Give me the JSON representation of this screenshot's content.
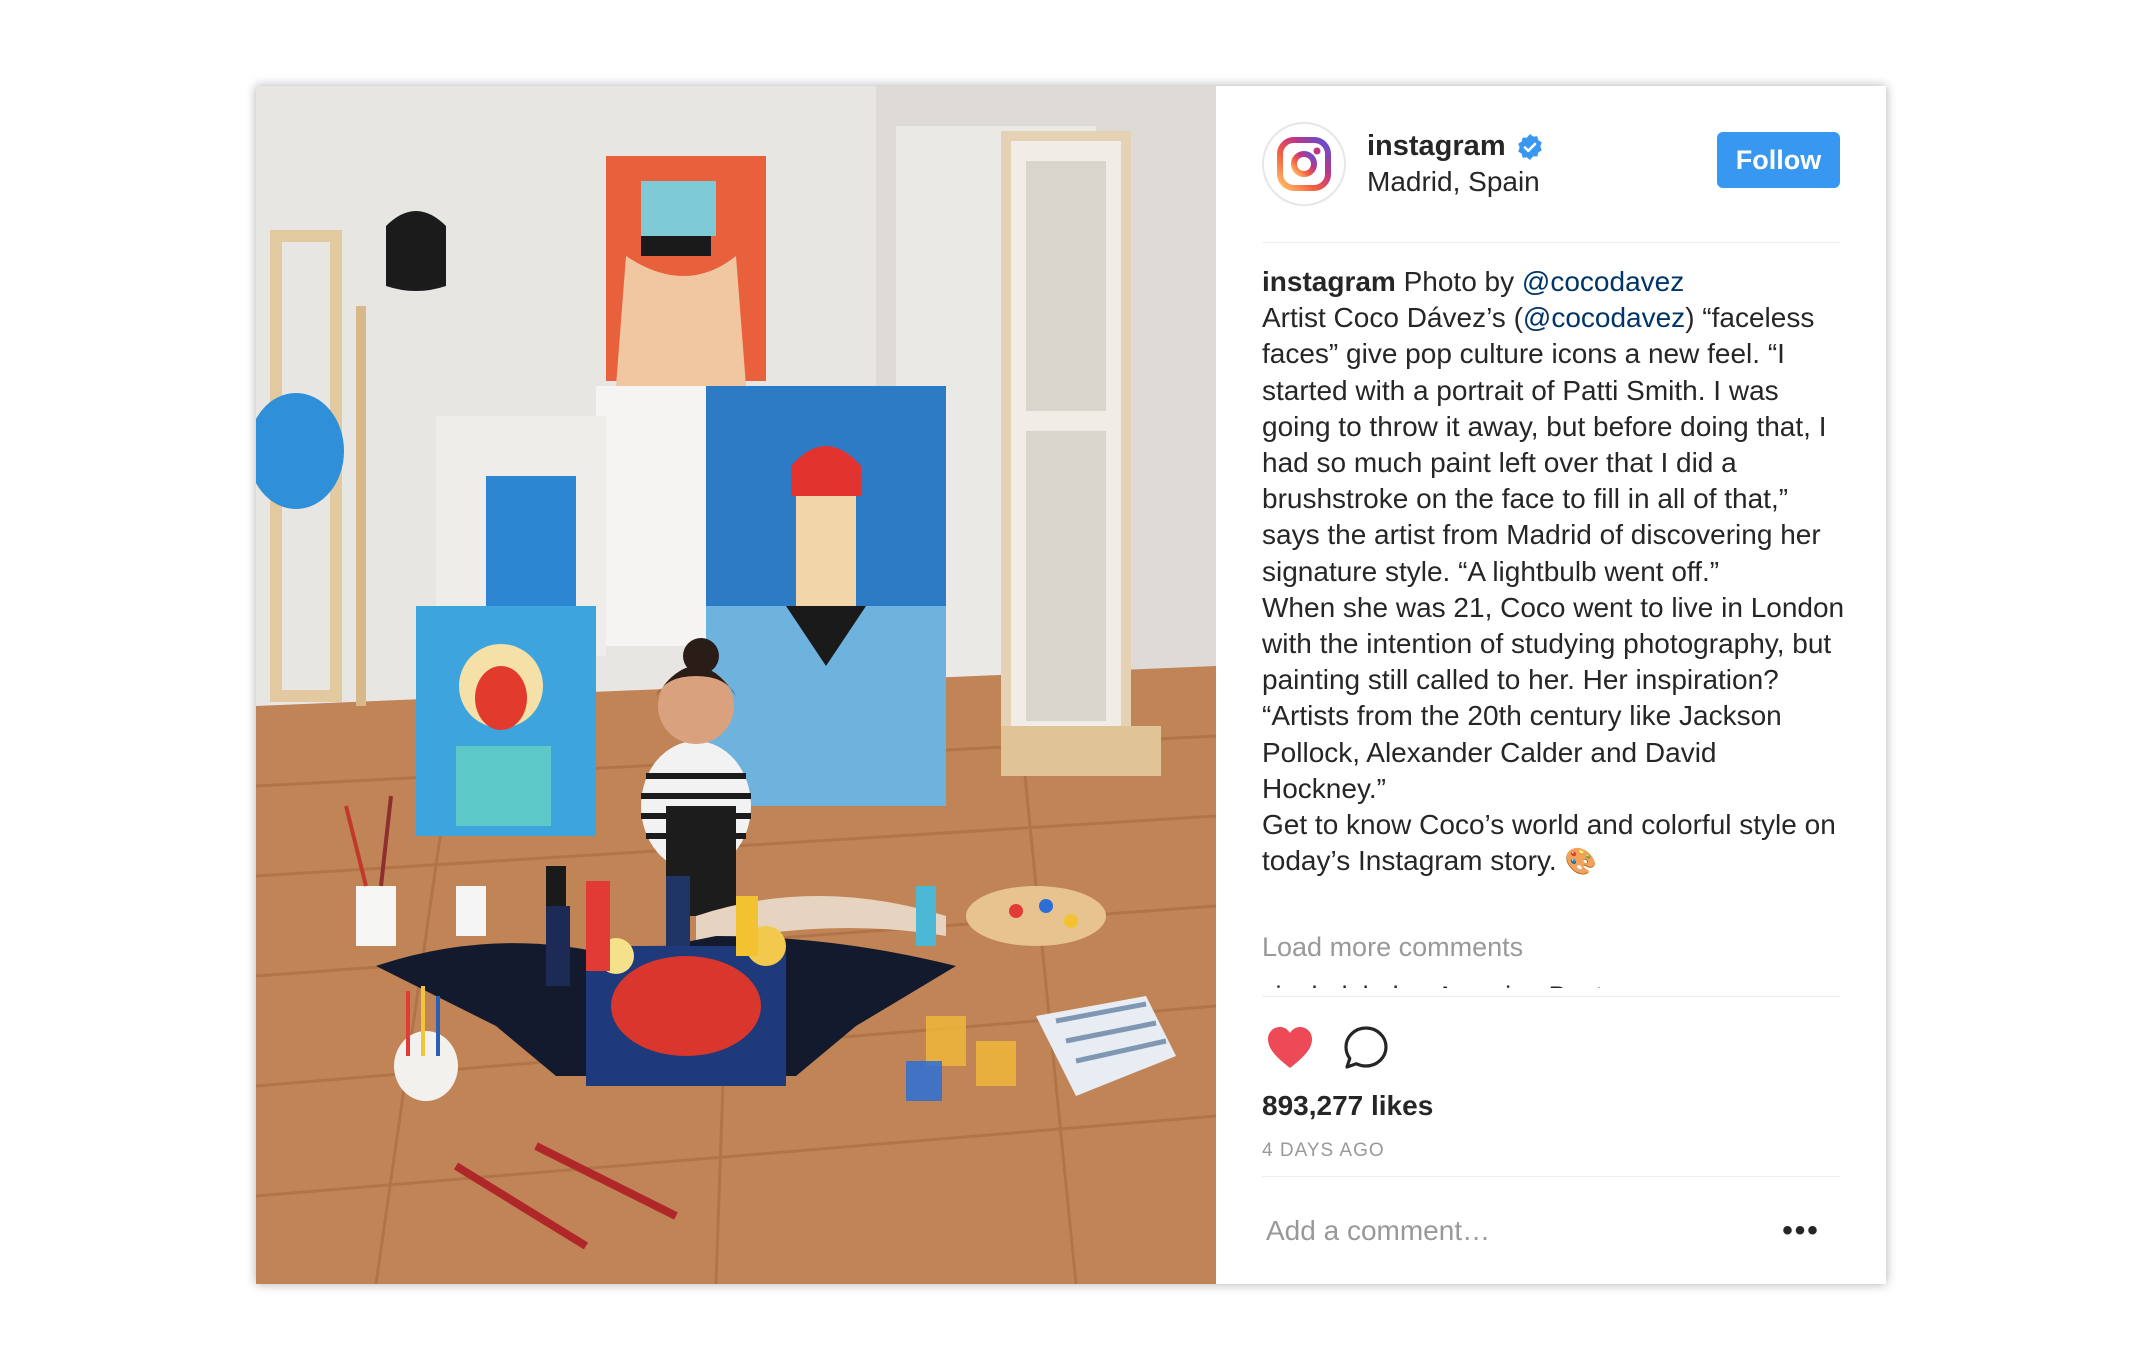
{
  "post": {
    "image_alt": "Artist painting on studio floor surrounded by colorful portraits",
    "user": {
      "username": "instagram",
      "location": "Madrid, Spain",
      "follow_label": "Follow"
    },
    "caption": {
      "username": "instagram",
      "intro": " Photo by ",
      "mention1": "@cocodavez",
      "line2_pre": "Artist Coco Dávez’s (",
      "mention2": "@cocodavez",
      "line2_post": ") “faceless faces” give pop culture icons a new feel. “I started with a portrait of Patti Smith. I was going to throw it away, but before doing that, I had so much paint left over that I did a brushstroke on the face to fill in all of that,” says the artist from Madrid of discovering her signature style. “A lightbulb went off.”",
      "para2": "When she was 21, Coco went to live in London with the intention of studying photography, but painting still called to her. Her inspiration? “Artists from the 20th century like Jackson Pollock, Alexander Calder and David Hockney.”",
      "para3": "Get to know Coco’s world and colorful style on today’s Instagram story.",
      "emoji": "🎨"
    },
    "load_more": "Load more comments",
    "partial_comment": "xiaobolabola r Amazing Best",
    "likes": "893,277 likes",
    "timestamp": "4 DAYS AGO",
    "comment_placeholder": "Add a comment…",
    "more_glyph": "•••"
  },
  "colors": {
    "follow_bg": "#3897f0",
    "heart": "#ed4956",
    "mention": "#003569",
    "muted": "#999999"
  },
  "icons": [
    "instagram-logo-icon",
    "verified-badge-icon",
    "heart-icon",
    "comment-icon",
    "more-options-icon"
  ]
}
